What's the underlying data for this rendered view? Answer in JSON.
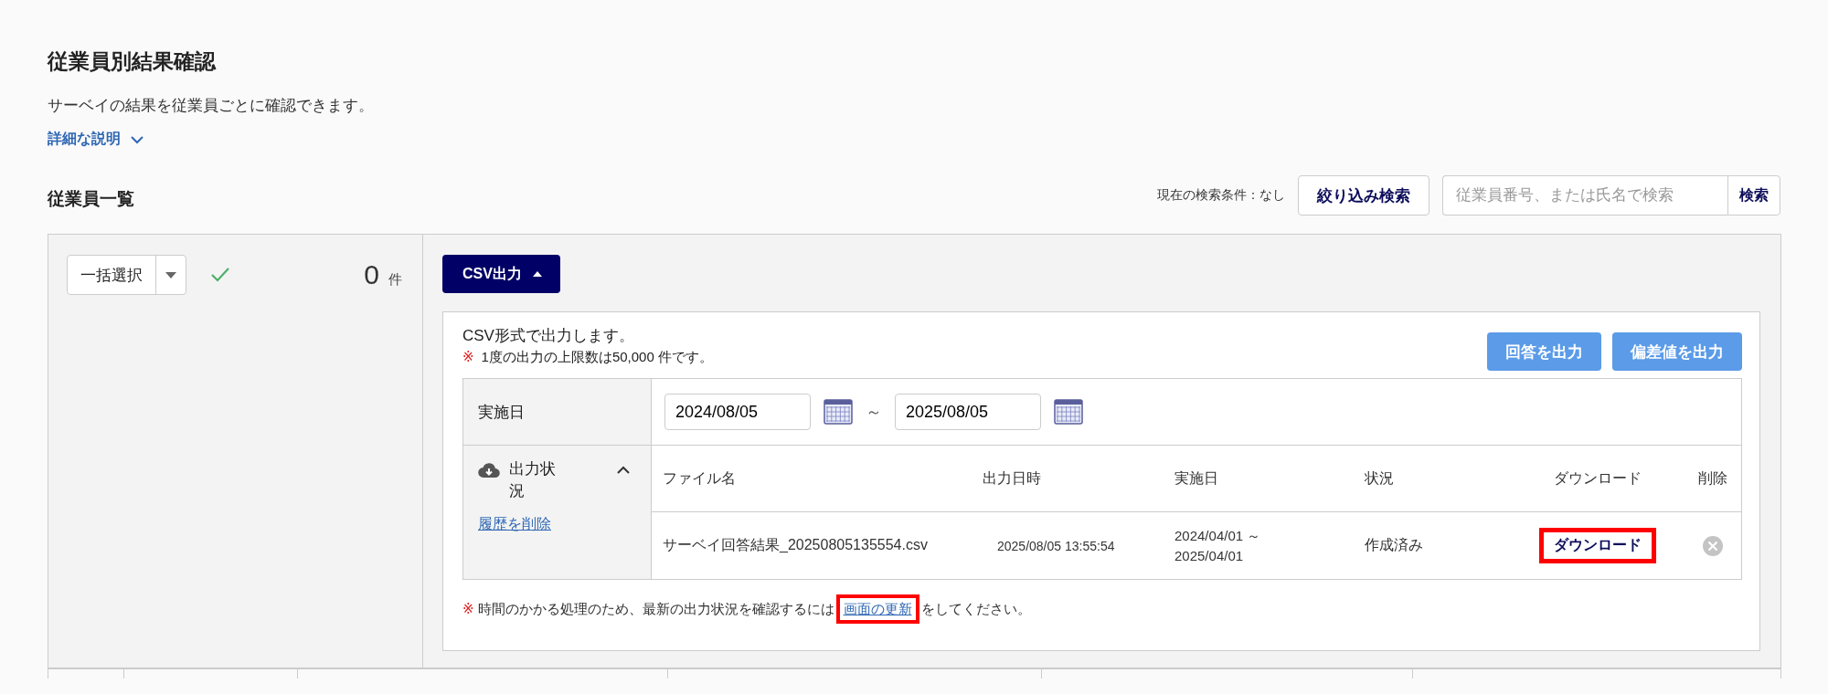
{
  "page": {
    "title": "従業員別結果確認",
    "description": "サーベイの結果を従業員ごとに確認できます。",
    "details_link": {
      "label": "詳細な説明",
      "expanded": false
    }
  },
  "list_header": {
    "title": "従業員一覧",
    "search_condition": "現在の検索条件：なし",
    "filter_button": "絞り込み検索",
    "search": {
      "placeholder": "従業員番号、または氏名で検索",
      "button": "検索"
    }
  },
  "left_panel": {
    "bulk_select": "一括選択",
    "count": "0",
    "count_unit": "件"
  },
  "csv_button": {
    "label": "CSV出力",
    "expanded": true
  },
  "csv_panel": {
    "description": "CSV形式で出力します。",
    "limit_note": {
      "mark": "※",
      "text": "1度の出力の上限数は50,000 件です。"
    },
    "buttons": [
      "回答を出力",
      "偏差値を出力"
    ],
    "date_row": {
      "label": "実施日",
      "from": "2024/08/05",
      "separator": "～",
      "to": "2025/08/05"
    },
    "status": {
      "label": "出力状況",
      "expanded": true,
      "delete_history": "履歴を削除",
      "columns": [
        "ファイル名",
        "出力日時",
        "実施日",
        "状況",
        "ダウンロード",
        "削除"
      ],
      "rows": [
        {
          "file_name": "サーベイ回答結果_20250805135554.csv",
          "output_at": "2025/08/05 13:55:54",
          "period": [
            "2024/04/01 ～",
            "2025/04/01"
          ],
          "status": "作成済み",
          "download": {
            "label": "ダウンロード",
            "highlighted": true
          }
        }
      ]
    },
    "footer_note": {
      "mark": "※",
      "before": "時間のかかる処理のため、最新の出力状況を確認するには",
      "link": {
        "label": "画面の更新",
        "highlighted": true
      },
      "after": "をしてください。"
    }
  }
}
